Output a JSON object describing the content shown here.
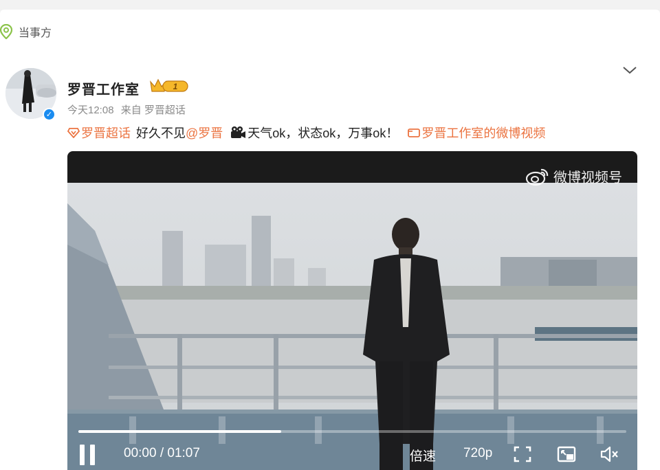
{
  "party": {
    "label": "当事方",
    "icon": "location-pin-icon"
  },
  "author": {
    "name": "罗晋工作室",
    "badge_level": "1",
    "verified": true
  },
  "meta": {
    "time": "今天12:08",
    "source": "来自 罗晋超话"
  },
  "post": {
    "topic": "罗晋超话",
    "text1": "好久不见",
    "mention": "@罗晋",
    "text2": "天气ok，状态ok，万事ok！",
    "video_link": "罗晋工作室的微博视频"
  },
  "video": {
    "watermark": "微博视频号",
    "current_time": "00:00",
    "duration": "01:07",
    "time_display": "00:00 / 01:07",
    "progress_fraction": 0.37,
    "speed_label": "倍速",
    "quality_label": "720p"
  },
  "colors": {
    "accent": "#eb7340",
    "verified": "#1a8cf0",
    "badge": "#f5b72a"
  }
}
